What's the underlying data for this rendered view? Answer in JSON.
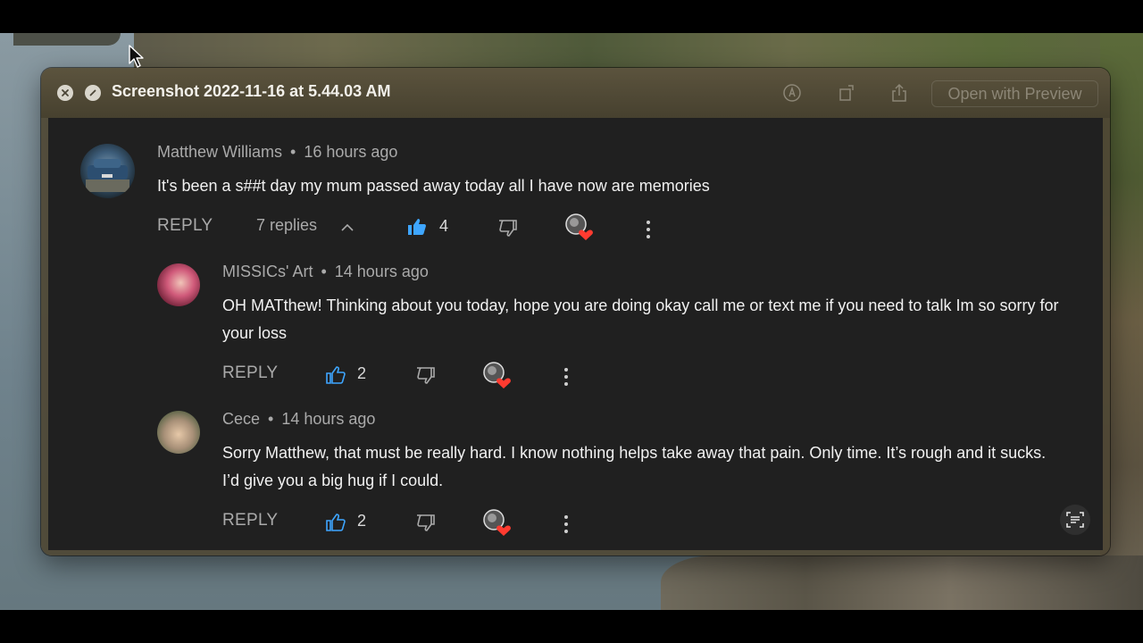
{
  "window": {
    "title": "Screenshot 2022-11-16 at 5.44.03 AM",
    "open_with_label": "Open with Preview",
    "toolbar_icons": [
      "markup-icon",
      "rotate-icon",
      "share-icon"
    ]
  },
  "comments": [
    {
      "author": "Matthew Williams",
      "time": "16 hours ago",
      "text": "It's been a s##t day my mum passed away today all I have now are memories",
      "reply_label": "REPLY",
      "replies_label": "7 replies",
      "likes": "4",
      "liked": true
    },
    {
      "author": "MISSICs' Art",
      "time": "14 hours ago",
      "text": "OH MATthew!  Thinking about you today, hope you are doing okay call me or text me if you need to talk Im so sorry for your loss",
      "reply_label": "REPLY",
      "likes": "2",
      "liked": false
    },
    {
      "author": "Cece",
      "time": "14 hours ago",
      "text": "Sorry Matthew, that must be really hard. I know nothing helps take away that pain. Only time. It’s rough and it sucks. I’d give you a big hug if I could.",
      "reply_label": "REPLY",
      "likes": "2",
      "liked": false
    }
  ],
  "colors": {
    "like_active": "#3ea6ff",
    "heart": "#ff3b30",
    "background": "#202020"
  }
}
